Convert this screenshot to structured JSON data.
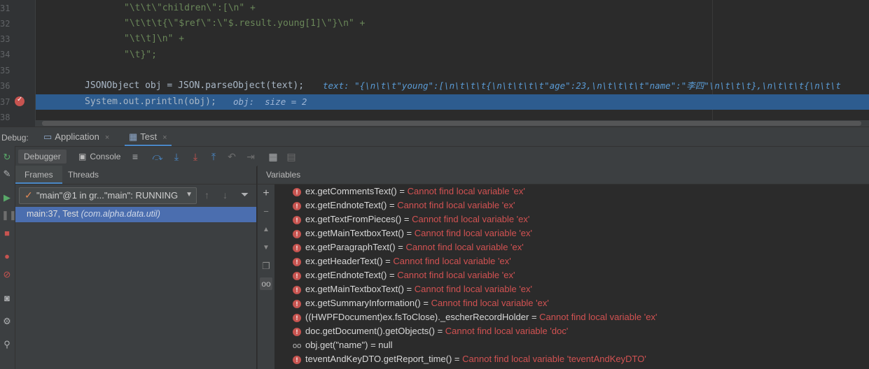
{
  "editor": {
    "line_numbers": [
      "31",
      "32",
      "33",
      "34",
      "35",
      "36",
      "37",
      "38"
    ],
    "lines": [
      {
        "n": "31",
        "code": "\"\\t\\t\\\"children\\\":[\\n\" +"
      },
      {
        "n": "32",
        "code": "\"\\t\\t\\t{\\\"$ref\\\":\\\"$.result.young[1]\\\"}\\n\" +"
      },
      {
        "n": "33",
        "code": "\"\\t\\t]\\n\" +"
      },
      {
        "n": "34",
        "code": "\"\\t}\";"
      },
      {
        "n": "35",
        "code": ""
      },
      {
        "n": "36",
        "code": "JSONObject obj = JSON.parseObject(text);",
        "hint": "text: \"{\\n\\t\\t\"young\":[\\n\\t\\t\\t{\\n\\t\\t\\t\\t\"age\":23,\\n\\t\\t\\t\\t\"name\":\"李四\"\\n\\t\\t\\t},\\n\\t\\t\\t{\\n\\t\\t"
      },
      {
        "n": "37",
        "code": "System.out.println(obj);",
        "hint": "obj:  size = 2"
      },
      {
        "n": "38",
        "code": ""
      }
    ],
    "current_line": "37",
    "accent_exec": "#2d5c8f"
  },
  "debug_bar": {
    "label": "Debug:",
    "tabs": [
      {
        "label": "Application",
        "close": "×"
      },
      {
        "label": "Test",
        "close": "×"
      }
    ]
  },
  "toolbar": {
    "debugger_label": "Debugger",
    "console_label": "Console",
    "icons": [
      "menu-icon",
      "step-over-icon",
      "step-into-icon",
      "force-step-into-icon",
      "step-out-icon",
      "run-to-cursor-icon",
      "evaluate-icon",
      "table-icon",
      "layout-icon"
    ]
  },
  "frames": {
    "tab_frames": "Frames",
    "tab_threads": "Threads",
    "thread_selector": "\"main\"@1 in gr...\"main\": RUNNING",
    "frame_row_main": "main:37, Test",
    "frame_row_pkg": "(com.alpha.data.util)"
  },
  "variables": {
    "title": "Variables",
    "rows": [
      {
        "name": "ex.getCommentsText()",
        "eq": " = ",
        "val": "Cannot find local variable 'ex'",
        "kind": "error"
      },
      {
        "name": "ex.getEndnoteText()",
        "eq": " = ",
        "val": "Cannot find local variable 'ex'",
        "kind": "error"
      },
      {
        "name": "ex.getTextFromPieces()",
        "eq": " = ",
        "val": "Cannot find local variable 'ex'",
        "kind": "error"
      },
      {
        "name": "ex.getMainTextboxText()",
        "eq": " = ",
        "val": "Cannot find local variable 'ex'",
        "kind": "error"
      },
      {
        "name": "ex.getParagraphText()",
        "eq": " = ",
        "val": "Cannot find local variable 'ex'",
        "kind": "error"
      },
      {
        "name": "ex.getHeaderText()",
        "eq": " = ",
        "val": "Cannot find local variable 'ex'",
        "kind": "error"
      },
      {
        "name": "ex.getEndnoteText()",
        "eq": " = ",
        "val": "Cannot find local variable 'ex'",
        "kind": "error"
      },
      {
        "name": "ex.getMainTextboxText()",
        "eq": " = ",
        "val": "Cannot find local variable 'ex'",
        "kind": "error"
      },
      {
        "name": "ex.getSummaryInformation()",
        "eq": " = ",
        "val": "Cannot find local variable 'ex'",
        "kind": "error"
      },
      {
        "name": "((HWPFDocument)ex.fsToClose)._escherRecordHolder",
        "eq": " = ",
        "val": "Cannot find local variable 'ex'",
        "kind": "error"
      },
      {
        "name": "doc.getDocument().getObjects()",
        "eq": " = ",
        "val": "Cannot find local variable 'doc'",
        "kind": "error"
      },
      {
        "name": "obj.get(\"name\")",
        "eq": " = ",
        "val": "null",
        "kind": "watch"
      },
      {
        "name": "teventAndKeyDTO.getReport_time()",
        "eq": " = ",
        "val": "Cannot find local variable 'teventAndKeyDTO'",
        "kind": "error"
      }
    ]
  }
}
